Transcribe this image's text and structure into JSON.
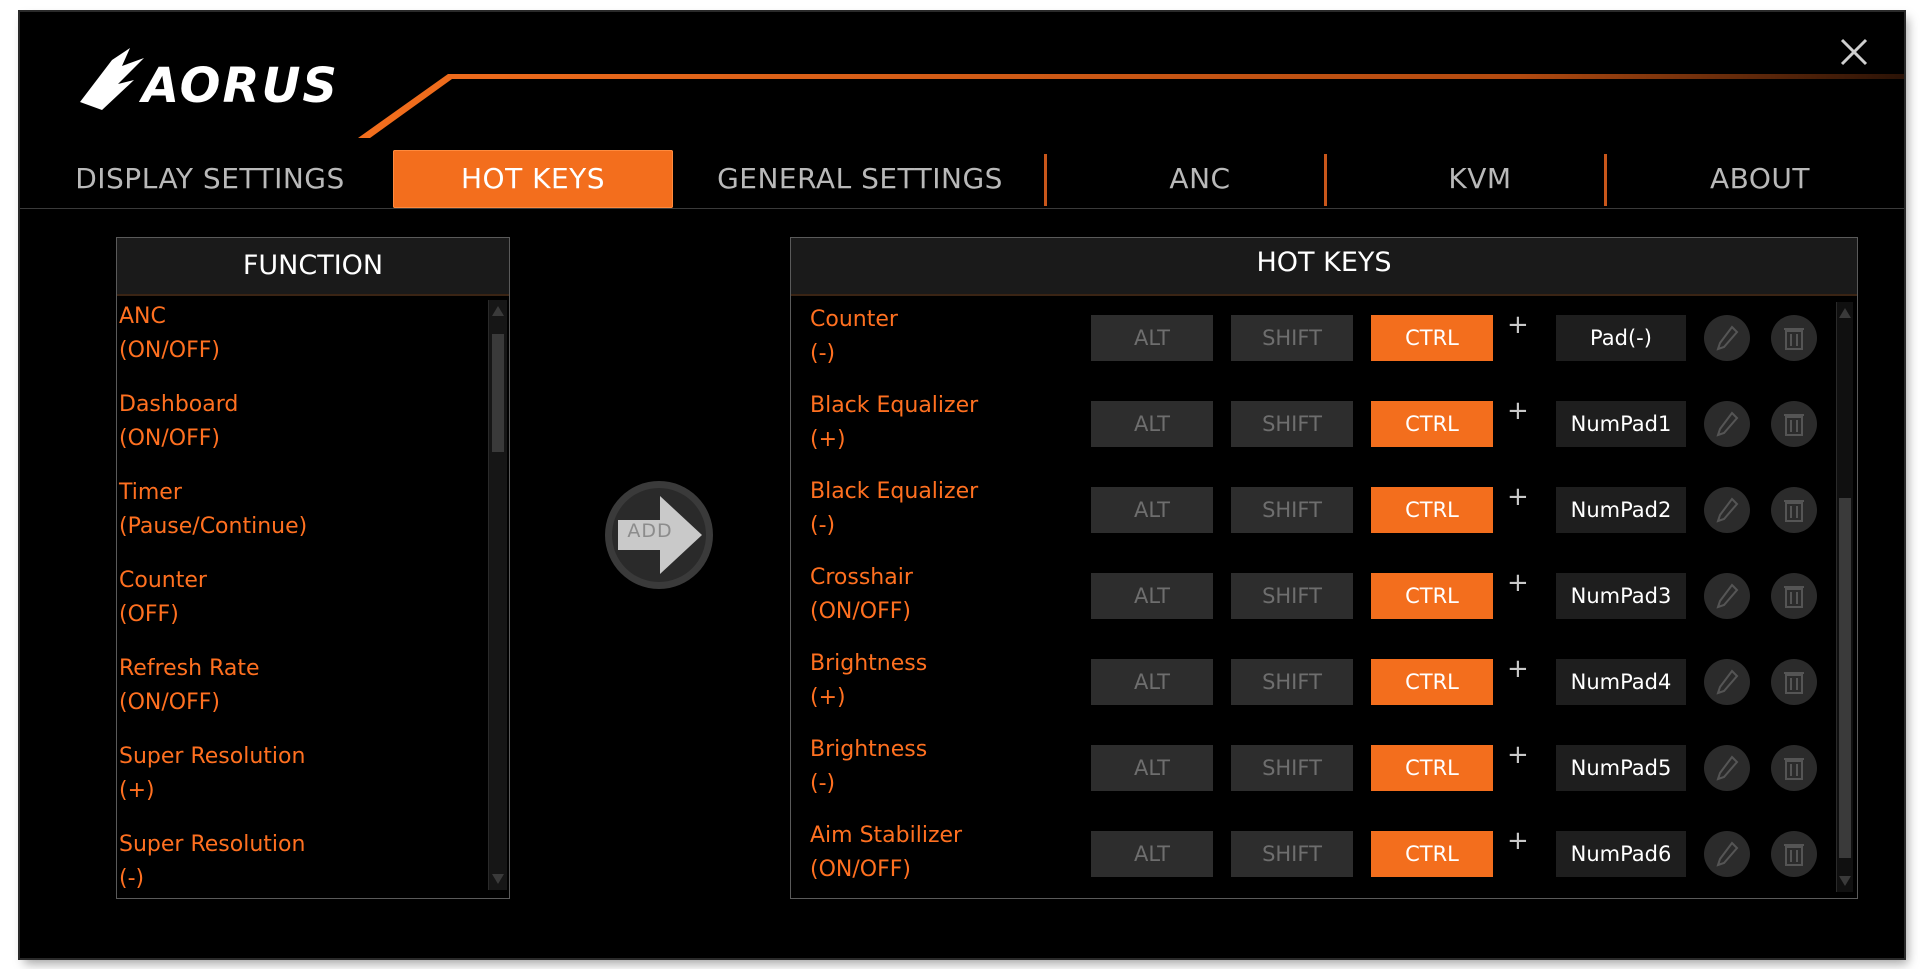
{
  "app": {
    "logo_text": "AORUS"
  },
  "tabs": [
    {
      "label": "DISPLAY SETTINGS",
      "active": false
    },
    {
      "label": "HOT KEYS",
      "active": true
    },
    {
      "label": "GENERAL SETTINGS",
      "active": false
    },
    {
      "label": "ANC",
      "active": false
    },
    {
      "label": "KVM",
      "active": false
    },
    {
      "label": "ABOUT",
      "active": false
    }
  ],
  "function_panel": {
    "title": "FUNCTION",
    "items": [
      {
        "name": "ANC",
        "mode": "(ON/OFF)"
      },
      {
        "name": "Dashboard",
        "mode": "(ON/OFF)"
      },
      {
        "name": "Timer",
        "mode": "(Pause/Continue)"
      },
      {
        "name": "Counter",
        "mode": "(OFF)"
      },
      {
        "name": "Refresh Rate",
        "mode": "(ON/OFF)"
      },
      {
        "name": "Super Resolution",
        "mode": "(+)"
      },
      {
        "name": "Super Resolution",
        "mode": "(-)"
      }
    ]
  },
  "add_button": {
    "label": "ADD"
  },
  "hotkeys_panel": {
    "title": "HOT KEYS",
    "modifier_labels": {
      "alt": "ALT",
      "shift": "SHIFT",
      "ctrl": "CTRL"
    },
    "plus": "+",
    "rows": [
      {
        "name": "Counter",
        "mode": "(-)",
        "key": "Pad(-)",
        "ctrl": true
      },
      {
        "name": "Black Equalizer",
        "mode": "(+)",
        "key": "NumPad1",
        "ctrl": true
      },
      {
        "name": "Black Equalizer",
        "mode": "(-)",
        "key": "NumPad2",
        "ctrl": true
      },
      {
        "name": "Crosshair",
        "mode": "(ON/OFF)",
        "key": "NumPad3",
        "ctrl": true
      },
      {
        "name": "Brightness",
        "mode": "(+)",
        "key": "NumPad4",
        "ctrl": true
      },
      {
        "name": "Brightness",
        "mode": "(-)",
        "key": "NumPad5",
        "ctrl": true
      },
      {
        "name": "Aim Stabilizer",
        "mode": "(ON/OFF)",
        "key": "NumPad6",
        "ctrl": true
      }
    ]
  },
  "colors": {
    "accent": "#f36e1d",
    "text_orange": "#ff7020",
    "background": "#000000",
    "inactive_key": "#2d2d2d"
  },
  "icons": {
    "close": "close-icon",
    "add": "arrow-right-icon",
    "edit": "pencil-icon",
    "delete": "trash-icon"
  }
}
